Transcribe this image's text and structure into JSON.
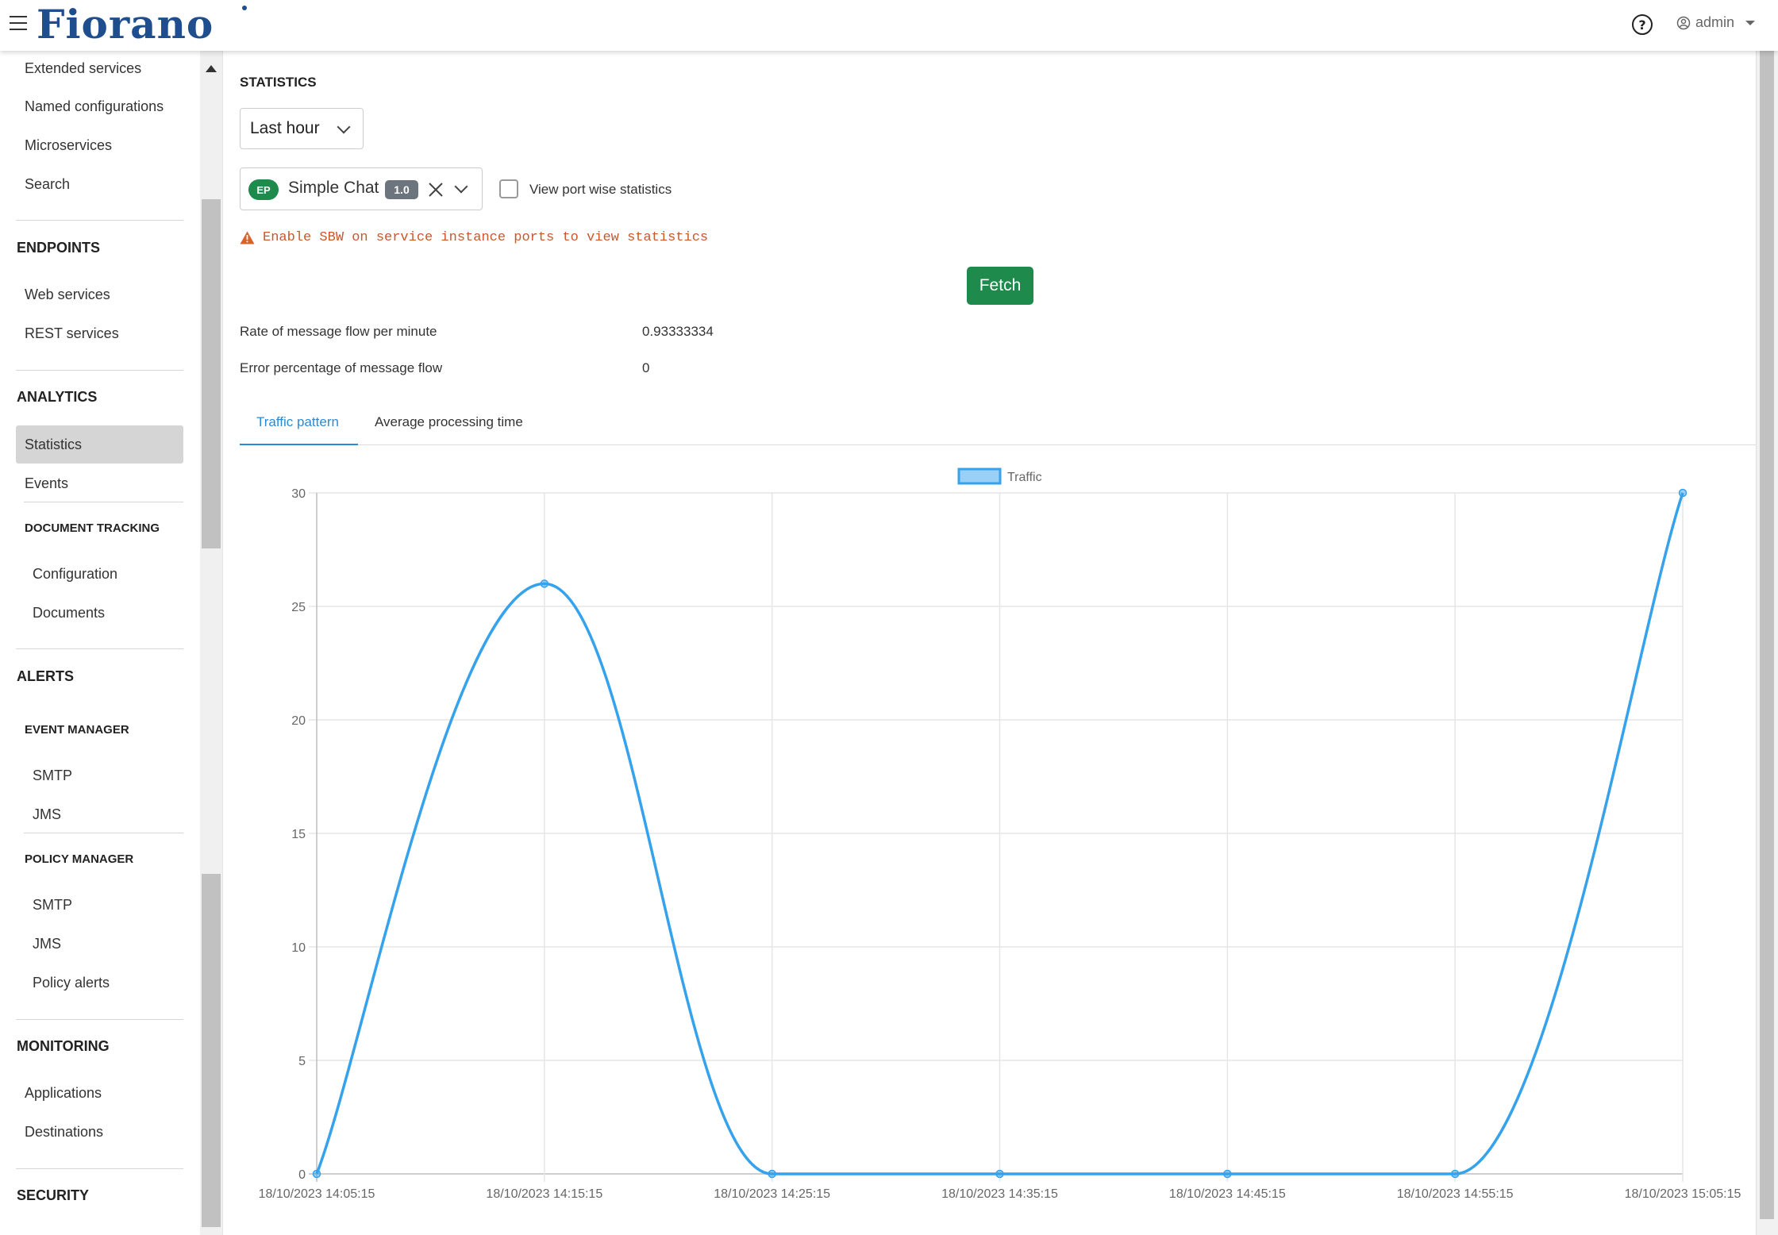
{
  "app": {
    "logo_text": "Fiorano",
    "user": "admin"
  },
  "sidebar": {
    "items": [
      {
        "label": "Extended services"
      },
      {
        "label": "Named configurations"
      },
      {
        "label": "Microservices"
      },
      {
        "label": "Search"
      }
    ],
    "endpoints": {
      "heading": "ENDPOINTS",
      "items": [
        "Web services",
        "REST services"
      ]
    },
    "analytics": {
      "heading": "ANALYTICS",
      "items": [
        "Statistics",
        "Events"
      ],
      "active": "Statistics"
    },
    "document_tracking": {
      "heading": "DOCUMENT TRACKING",
      "items": [
        "Configuration",
        "Documents"
      ]
    },
    "alerts": {
      "heading": "ALERTS"
    },
    "event_manager": {
      "heading": "EVENT MANAGER",
      "items": [
        "SMTP",
        "JMS"
      ]
    },
    "policy_manager": {
      "heading": "POLICY MANAGER",
      "items": [
        "SMTP",
        "JMS",
        "Policy alerts"
      ]
    },
    "monitoring": {
      "heading": "MONITORING",
      "items": [
        "Applications",
        "Destinations"
      ]
    },
    "security": {
      "heading": "SECURITY"
    }
  },
  "main": {
    "title": "STATISTICS",
    "period_select": "Last hour",
    "service": {
      "badge": "EP",
      "name": "Simple Chat",
      "version": "1.0"
    },
    "port_wise_label": "View port wise statistics",
    "warning": "Enable SBW on service instance ports to view statistics",
    "fetch_label": "Fetch",
    "rate_label": "Rate of message flow per minute",
    "rate_value": "0.93333334",
    "error_label": "Error percentage of message flow",
    "error_value": "0",
    "tabs": [
      "Traffic pattern",
      "Average processing time"
    ],
    "active_tab": "Traffic pattern"
  },
  "colors": {
    "accent": "#2b8ad6",
    "primary_button": "#1e8a4c",
    "warning": "#c8582a",
    "line": "#36a2eb"
  },
  "chart_data": {
    "type": "line",
    "x": [
      "18/10/2023 14:05:15",
      "18/10/2023 14:15:15",
      "18/10/2023 14:25:15",
      "18/10/2023 14:35:15",
      "18/10/2023 14:45:15",
      "18/10/2023 14:55:15",
      "18/10/2023 15:05:15"
    ],
    "series": [
      {
        "name": "Traffic",
        "values": [
          0,
          26,
          0,
          0,
          0,
          0,
          30
        ]
      }
    ],
    "ylim": [
      0,
      30
    ],
    "yticks": [
      0,
      5,
      10,
      15,
      20,
      25,
      30
    ],
    "grid": true,
    "legend": "top"
  }
}
